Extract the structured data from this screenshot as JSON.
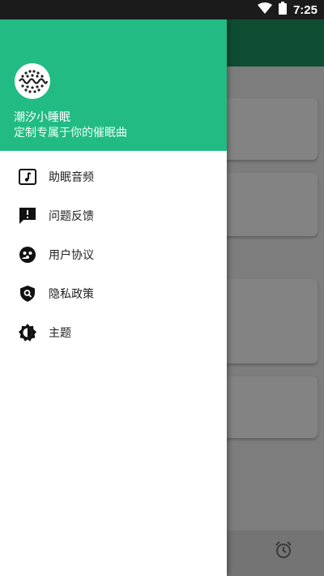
{
  "status_bar": {
    "time": "7:25",
    "icons": [
      "wifi-icon",
      "battery-icon"
    ]
  },
  "drawer": {
    "app_name": "潮汐小睡眠",
    "tagline": "定制专属于你的催眠曲",
    "items": [
      {
        "label": "助眠音频",
        "icon": "music-note-icon"
      },
      {
        "label": "问题反馈",
        "icon": "feedback-icon"
      },
      {
        "label": "用户协议",
        "icon": "agreement-icon"
      },
      {
        "label": "隐私政策",
        "icon": "privacy-shield-icon"
      },
      {
        "label": "主题",
        "icon": "theme-icon"
      }
    ]
  },
  "colors": {
    "header": "#22bb83",
    "toolbar": "#0f4d33",
    "scrim": "#7d7d7d"
  }
}
